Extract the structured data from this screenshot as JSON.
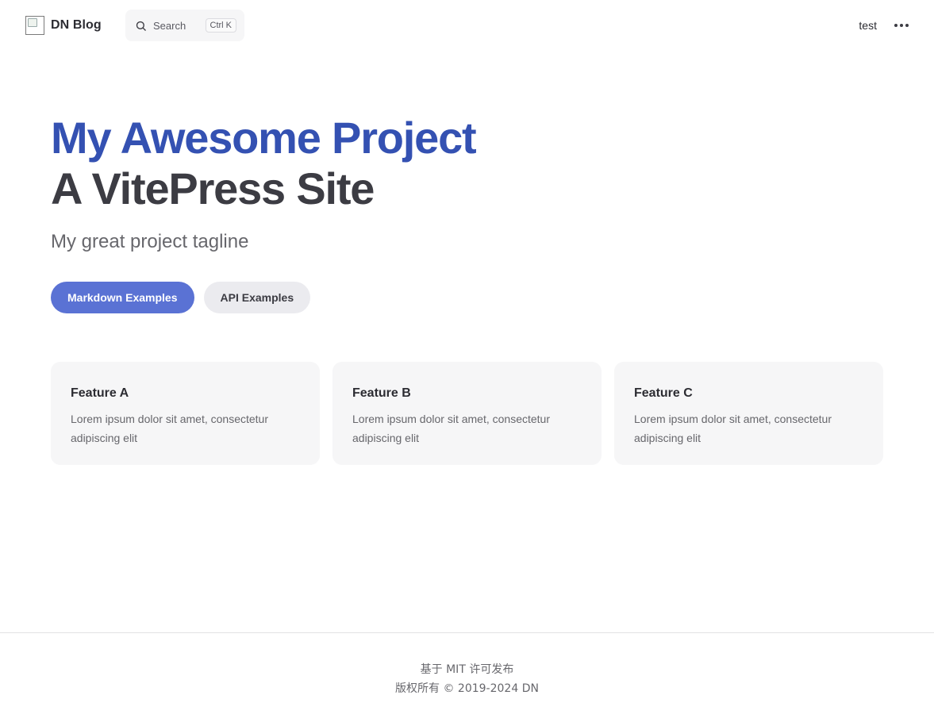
{
  "nav": {
    "site_title": "DN Blog",
    "logo_icon": "broken-image-icon",
    "search": {
      "label": "Search",
      "shortcut": "Ctrl K"
    },
    "links": [
      {
        "label": "test"
      }
    ],
    "more_icon": "ellipsis-icon"
  },
  "hero": {
    "name": "My Awesome Project",
    "text": "A VitePress Site",
    "tagline": "My great project tagline",
    "actions": [
      {
        "label": "Markdown Examples",
        "theme": "brand"
      },
      {
        "label": "API Examples",
        "theme": "alt"
      }
    ]
  },
  "features": [
    {
      "title": "Feature A",
      "details": "Lorem ipsum dolor sit amet, consectetur adipiscing elit"
    },
    {
      "title": "Feature B",
      "details": "Lorem ipsum dolor sit amet, consectetur adipiscing elit"
    },
    {
      "title": "Feature C",
      "details": "Lorem ipsum dolor sit amet, consectetur adipiscing elit"
    }
  ],
  "footer": {
    "message": "基于 MIT 许可发布",
    "copyright": "版权所有 © 2019-2024 DN"
  },
  "colors": {
    "brand": "#3451b2",
    "brand_button": "#5a72d4",
    "text": "#3c3c43",
    "muted": "#67676c",
    "surface": "#f6f6f7"
  }
}
